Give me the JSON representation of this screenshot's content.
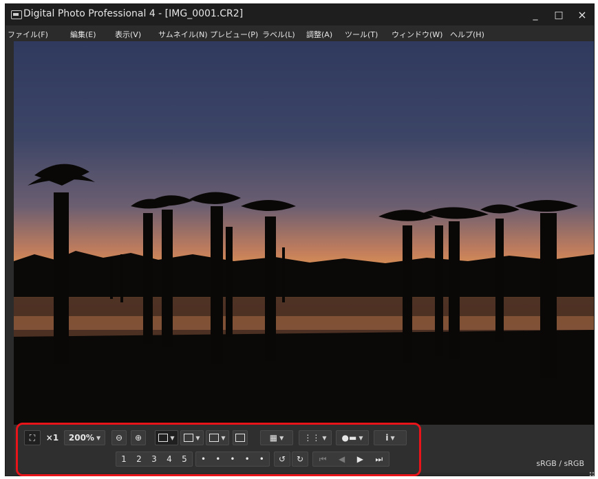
{
  "window": {
    "title": "Digital Photo Professional 4 - [IMG_0001.CR2]",
    "minimize": "_",
    "maximize": "□",
    "close": "×"
  },
  "menu": [
    "ファイル(F)",
    "編集(E)",
    "表示(V)",
    "サムネイル(N)",
    "プレビュー(P)",
    "ラベル(L)",
    "調整(A)",
    "ツール(T)",
    "ウィンドウ(W)",
    "ヘルプ(H)"
  ],
  "toolbar": {
    "fit_icon": "fit-screen-icon",
    "x1": "×1",
    "zoom": "200%",
    "zoom_out_icon": "zoom-out-icon",
    "zoom_in_icon": "zoom-in-icon",
    "af_point_icon": "af-point-icon",
    "compare_icon": "compare-icon",
    "split_icon": "split-view-icon",
    "thumbs_icon": "thumbnail-icon",
    "grid_icon": "grid-icon",
    "grid2_icon": "grid2-icon",
    "highlight_icon": "highlight-warning-icon",
    "info_icon": "info-icon",
    "ratings": [
      "1",
      "2",
      "3",
      "4",
      "5"
    ],
    "rating_dots": [
      "•",
      "•",
      "•",
      "•",
      "•"
    ],
    "rotate_left_icon": "rotate-left-icon",
    "rotate_right_icon": "rotate-right-icon",
    "first_icon": "first-icon",
    "prev_icon": "prev-icon",
    "next_icon": "next-icon",
    "last_icon": "last-icon"
  },
  "status": {
    "color_space": "sRGB / sRGB"
  }
}
